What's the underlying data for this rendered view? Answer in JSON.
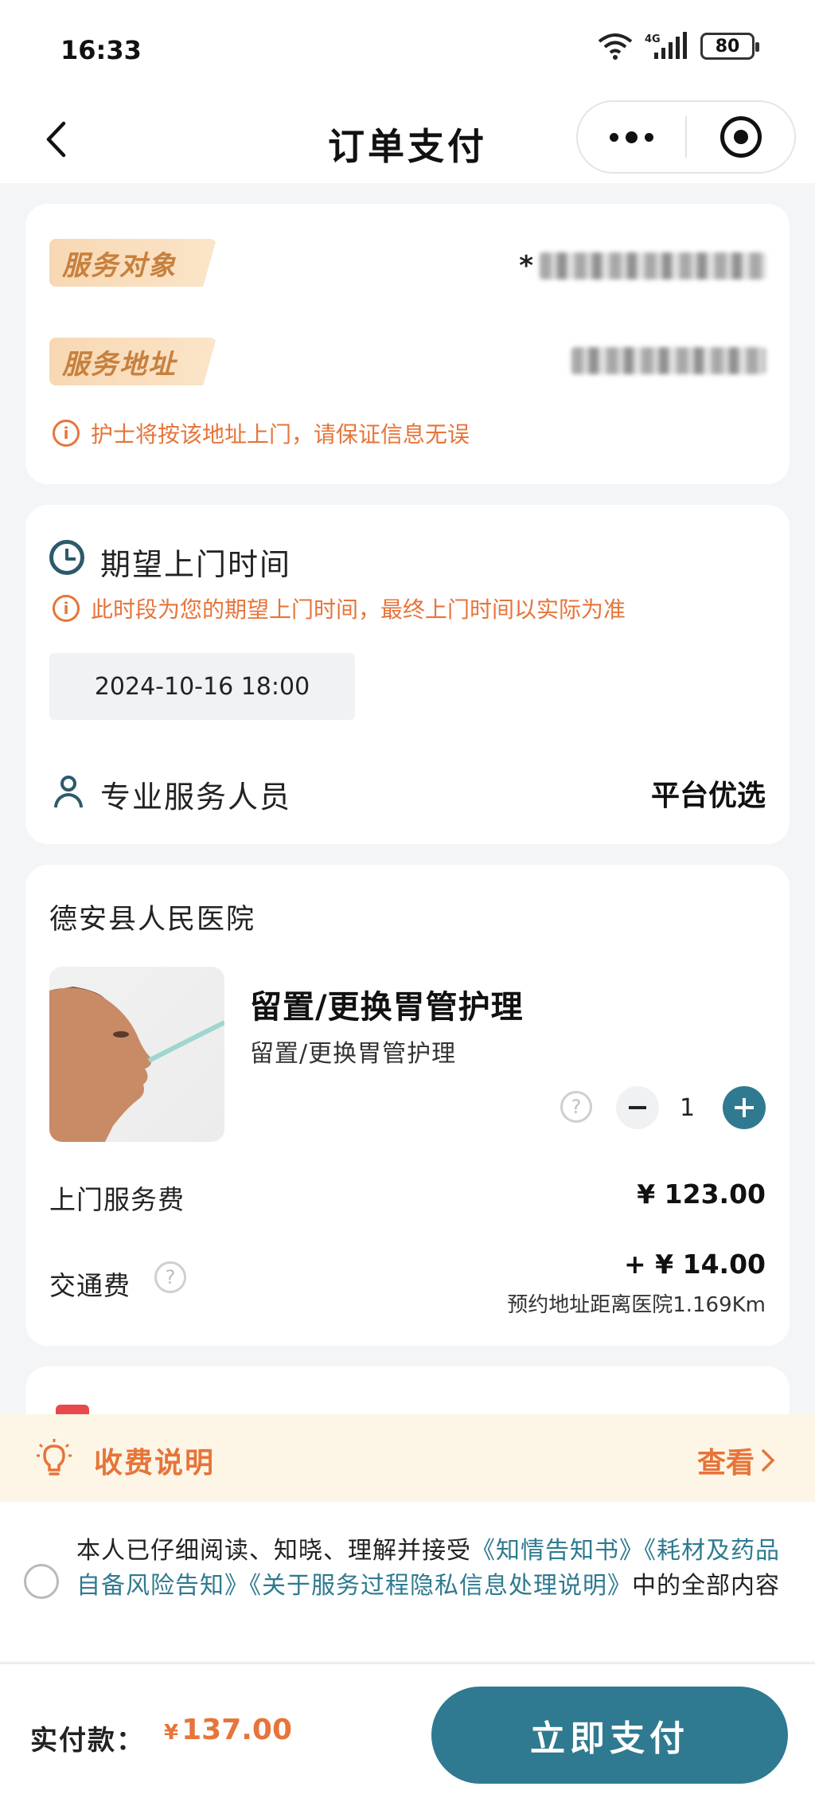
{
  "status_bar": {
    "time": "16:33",
    "battery": "80",
    "network": "4G"
  },
  "nav": {
    "title": "订单支付"
  },
  "service_card": {
    "target_tag": "服务对象",
    "target_value_prefix": "*",
    "address_tag": "服务地址",
    "warning": "护士将按该地址上门，请保证信息无误"
  },
  "time_card": {
    "title": "期望上门时间",
    "warning": "此时段为您的期望上门时间，最终上门时间以实际为准",
    "datetime": "2024-10-16 18:00",
    "staff_label": "专业服务人员",
    "staff_value": "平台优选"
  },
  "order_card": {
    "hospital": "德安县人民医院",
    "product_title": "留置/更换胃管护理",
    "product_subtitle": "留置/更换胃管护理",
    "quantity": "1",
    "service_fee_label": "上门服务费",
    "service_fee": "¥ 123.00",
    "transport_label": "交通费",
    "transport_fee": "+ ¥ 14.00",
    "distance_note": "预约地址距离医院1.169Km"
  },
  "fee_notice": {
    "title": "收费说明",
    "link": "查看"
  },
  "agreement": {
    "prefix": "本人已仔细阅读、知晓、理解并接受",
    "doc1": "《知情告知书》",
    "doc2": "《耗材及药品自备风险告知》",
    "doc3": "《关于服务过程隐私信息处理说明》",
    "suffix": "中的全部内容"
  },
  "bottom": {
    "pay_label": "实付款：",
    "currency": "¥",
    "amount": "137.00",
    "pay_button": "立即支付"
  },
  "colors": {
    "accent": "#2f7a90",
    "warning": "#e7743a",
    "tag_bg": "#f8d8b3"
  }
}
